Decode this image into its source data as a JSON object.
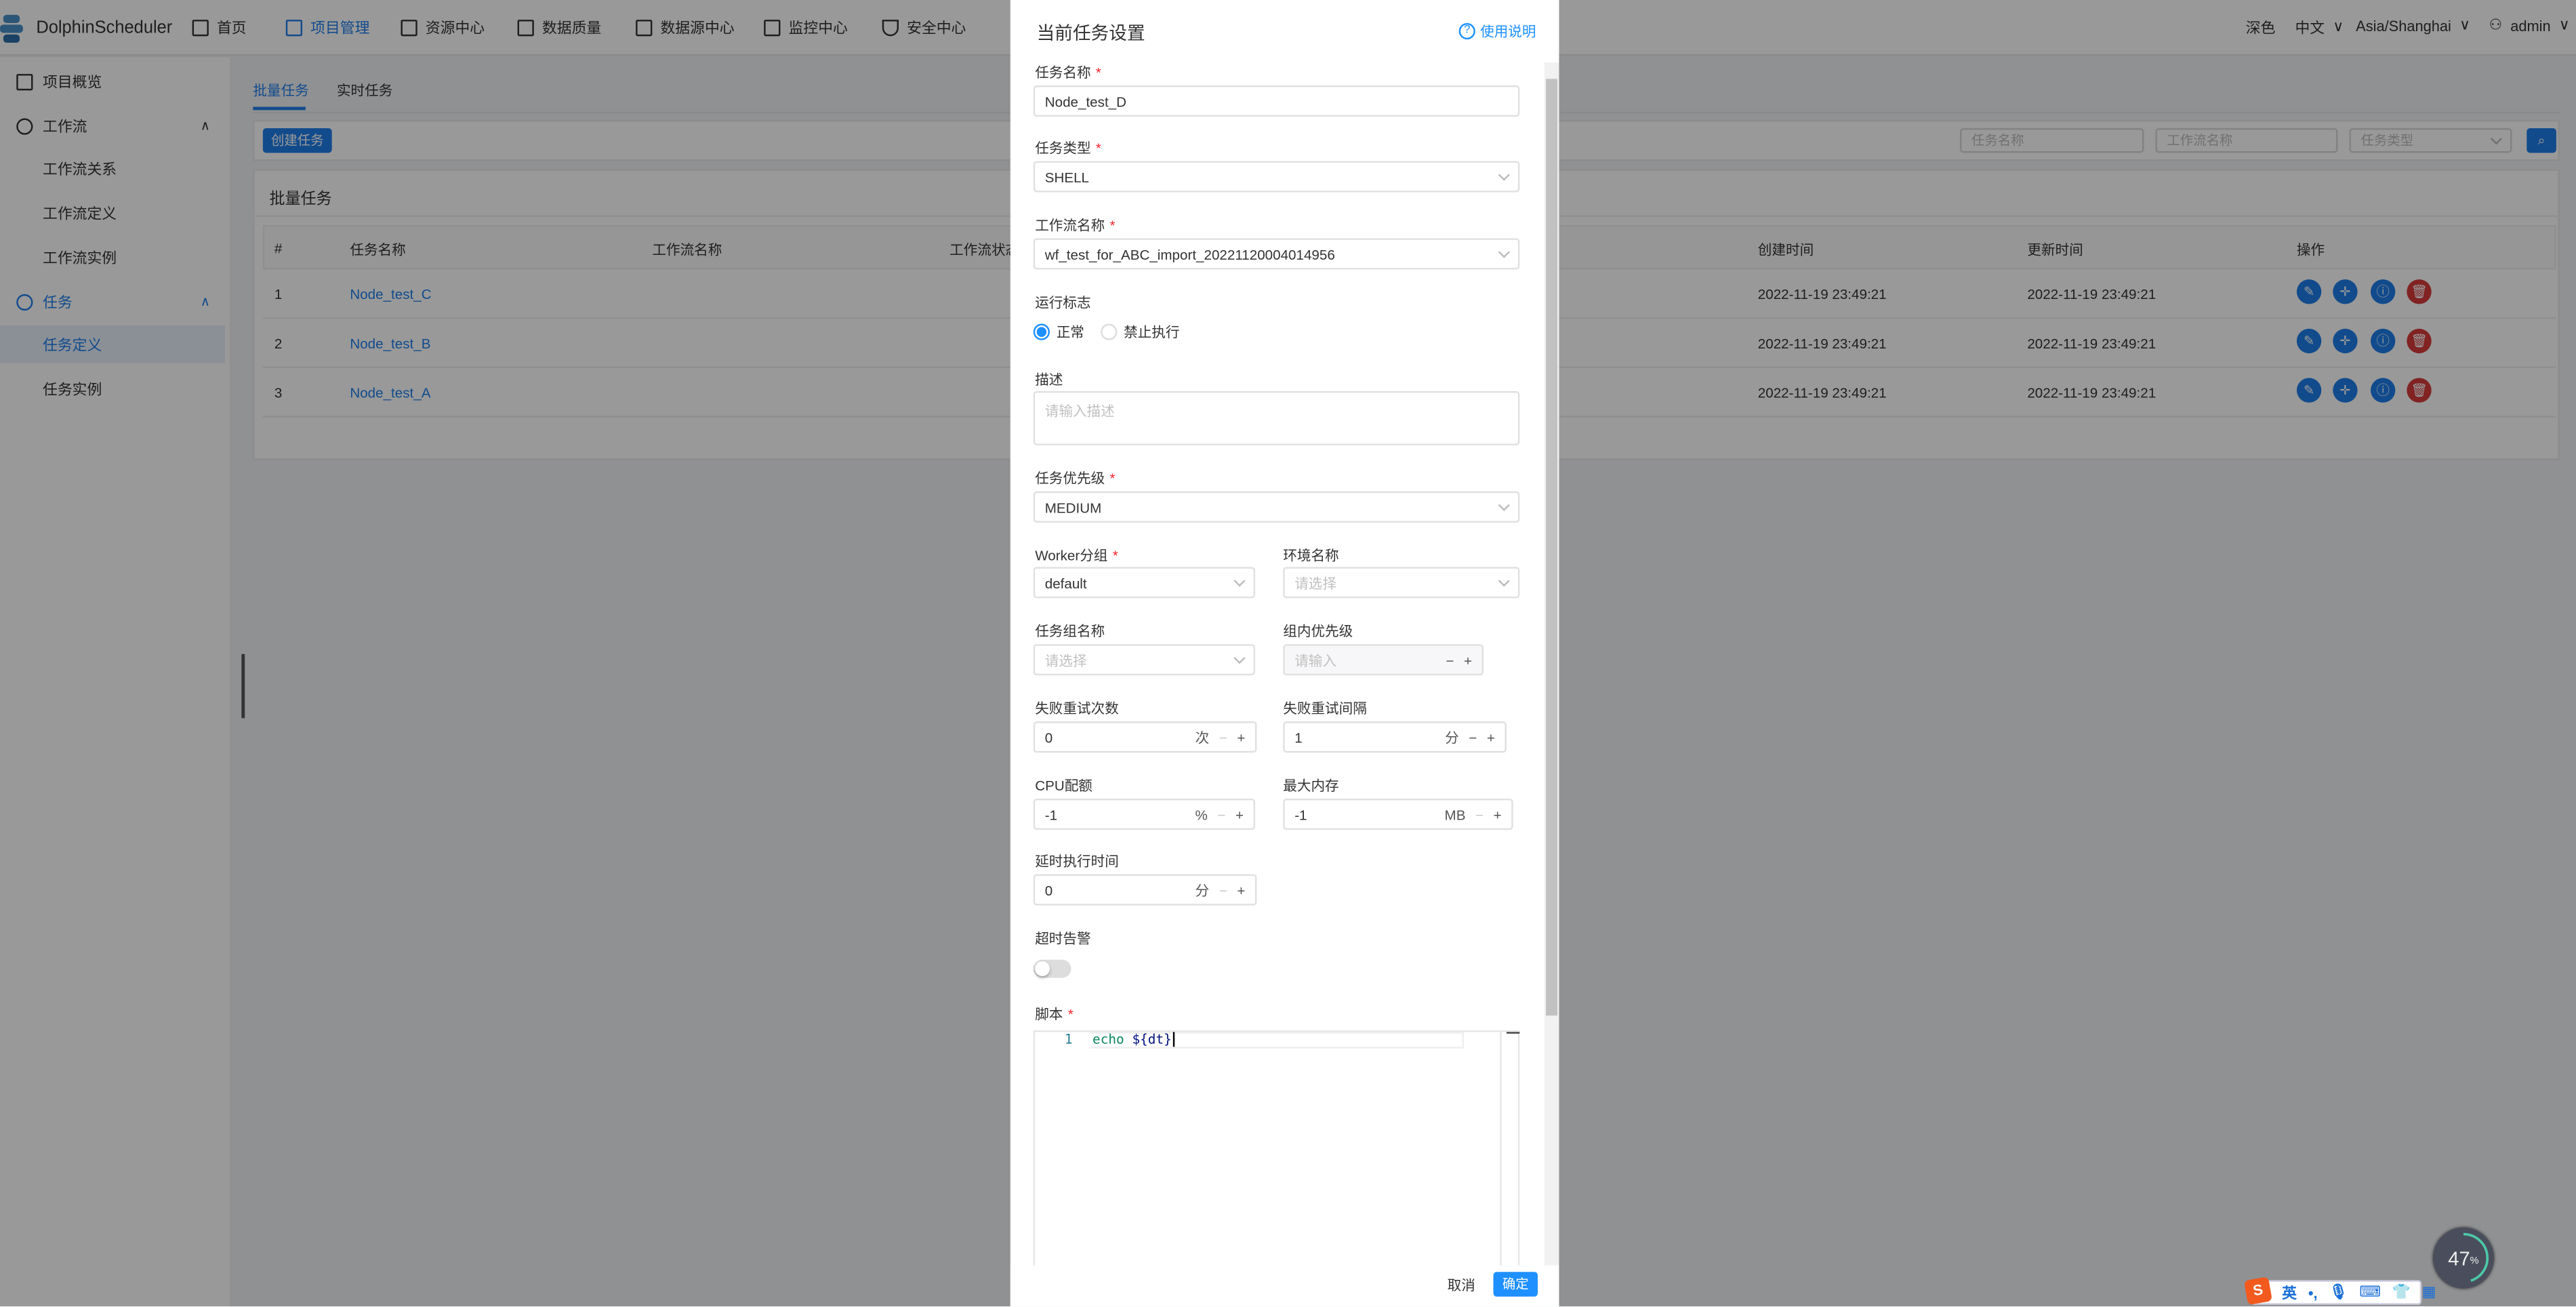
{
  "header": {
    "app_name": "DolphinScheduler",
    "nav": [
      {
        "label": "首页",
        "icon": "home-icon"
      },
      {
        "label": "项目管理",
        "icon": "project-icon",
        "active": true
      },
      {
        "label": "资源中心",
        "icon": "folder-icon"
      },
      {
        "label": "数据质量",
        "icon": "data-quality-icon"
      },
      {
        "label": "数据源中心",
        "icon": "datasource-icon"
      },
      {
        "label": "监控中心",
        "icon": "monitor-icon"
      },
      {
        "label": "安全中心",
        "icon": "shield-icon"
      }
    ],
    "theme": "深色",
    "language": "中文",
    "timezone": "Asia/Shanghai",
    "user": "admin"
  },
  "sidebar": {
    "items": [
      {
        "label": "项目概览"
      },
      {
        "label": "工作流"
      },
      {
        "label": "工作流关系"
      },
      {
        "label": "工作流定义"
      },
      {
        "label": "工作流实例"
      },
      {
        "label": "任务"
      },
      {
        "label": "任务定义",
        "active": true
      },
      {
        "label": "任务实例"
      }
    ]
  },
  "main": {
    "tabs": [
      "批量任务",
      "实时任务"
    ],
    "create_button": "创建任务",
    "search": {
      "task_name_placeholder": "任务名称",
      "workflow_name_placeholder": "工作流名称",
      "task_type_placeholder": "任务类型"
    },
    "card_title": "批量任务",
    "table": {
      "columns": [
        "#",
        "任务名称",
        "工作流名称",
        "工作流状态",
        "创建时间",
        "更新时间",
        "操作"
      ],
      "rows": [
        {
          "index": "1",
          "name": "Node_test_C",
          "created": "2022-11-19 23:49:21",
          "updated": "2022-11-19 23:49:21"
        },
        {
          "index": "2",
          "name": "Node_test_B",
          "created": "2022-11-19 23:49:21",
          "updated": "2022-11-19 23:49:21"
        },
        {
          "index": "3",
          "name": "Node_test_A",
          "created": "2022-11-19 23:49:21",
          "updated": "2022-11-19 23:49:21"
        }
      ]
    }
  },
  "drawer": {
    "title": "当前任务设置",
    "help": "使用说明",
    "task_name": {
      "label": "任务名称",
      "value": "Node_test_D"
    },
    "task_type": {
      "label": "任务类型",
      "value": "SHELL"
    },
    "workflow_name": {
      "label": "工作流名称",
      "value": "wf_test_for_ABC_import_20221120004014956"
    },
    "run_flag": {
      "label": "运行标志",
      "options": [
        "正常",
        "禁止执行"
      ],
      "selected": "正常"
    },
    "description": {
      "label": "描述",
      "placeholder": "请输入描述"
    },
    "priority": {
      "label": "任务优先级",
      "value": "MEDIUM"
    },
    "worker_group": {
      "label": "Worker分组",
      "value": "default"
    },
    "environment": {
      "label": "环境名称",
      "placeholder": "请选择"
    },
    "task_group": {
      "label": "任务组名称",
      "placeholder": "请选择"
    },
    "group_priority": {
      "label": "组内优先级",
      "placeholder": "请输入"
    },
    "retry_times": {
      "label": "失败重试次数",
      "value": "0",
      "unit": "次"
    },
    "retry_interval": {
      "label": "失败重试间隔",
      "value": "1",
      "unit": "分"
    },
    "cpu_quota": {
      "label": "CPU配额",
      "value": "-1",
      "unit": "%"
    },
    "max_memory": {
      "label": "最大内存",
      "value": "-1",
      "unit": "MB"
    },
    "delay_time": {
      "label": "延时执行时间",
      "value": "0",
      "unit": "分"
    },
    "timeout_alarm": {
      "label": "超时告警",
      "enabled": false
    },
    "script": {
      "label": "脚本",
      "line_number": "1",
      "code_keyword": "echo",
      "code_rest": "${dt}"
    },
    "cancel": "取消",
    "confirm": "确定"
  },
  "widget": {
    "value": "47",
    "unit": "%"
  },
  "ime": {
    "mode": "英",
    "punct": "•,"
  },
  "colors": {
    "accent": "#1e7ee9",
    "danger": "#d83b3b",
    "drawer_link": "#1e90ff"
  }
}
